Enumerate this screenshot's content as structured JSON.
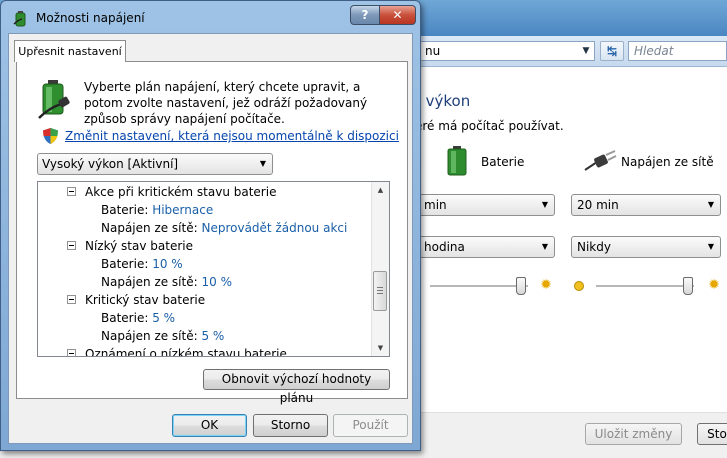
{
  "background": {
    "address_text": "nu",
    "search_placeholder": "Hledat",
    "heading": "ý výkon",
    "subtext": "eré má počítač používat.",
    "battery_label": "Baterie",
    "plugged_label": "Napájen ze sítě",
    "selects": [
      {
        "value": "min"
      },
      {
        "value": "20 min"
      },
      {
        "value": "hodina"
      },
      {
        "value": "Nikdy"
      }
    ],
    "save_button": "Uložit změny",
    "cancel_button": "Sto"
  },
  "dialog": {
    "title": "Možnosti napájení",
    "tab": "Upřesnit nastavení",
    "intro": "Vyberte plán napájení, který chcete upravit, a potom zvolte nastavení, jež odráží požadovaný způsob správy napájení počítače.",
    "change_link": "Změnit nastavení, která nejsou momentálně k dispozici",
    "plan_select": "Vysoký výkon [Aktivní]",
    "tree": [
      {
        "type": "group",
        "label": "Akce při kritickém stavu baterie"
      },
      {
        "type": "item",
        "label": "Baterie:",
        "value": "Hibernace"
      },
      {
        "type": "item",
        "label": "Napájen ze sítě:",
        "value": "Neprovádět žádnou akci"
      },
      {
        "type": "group",
        "label": "Nízký stav baterie"
      },
      {
        "type": "item",
        "label": "Baterie:",
        "value": "10 %"
      },
      {
        "type": "item",
        "label": "Napájen ze sítě:",
        "value": "10 %"
      },
      {
        "type": "group",
        "label": "Kritický stav baterie"
      },
      {
        "type": "item",
        "label": "Baterie:",
        "value": "5 %"
      },
      {
        "type": "item",
        "label": "Napájen ze sítě:",
        "value": "5 %"
      },
      {
        "type": "group",
        "label": "Oznámení o nízkém stavu baterie"
      }
    ],
    "restore_button": "Obnovit výchozí hodnoty plánu",
    "ok_button": "OK",
    "cancel_button": "Storno",
    "apply_button": "Použít"
  }
}
